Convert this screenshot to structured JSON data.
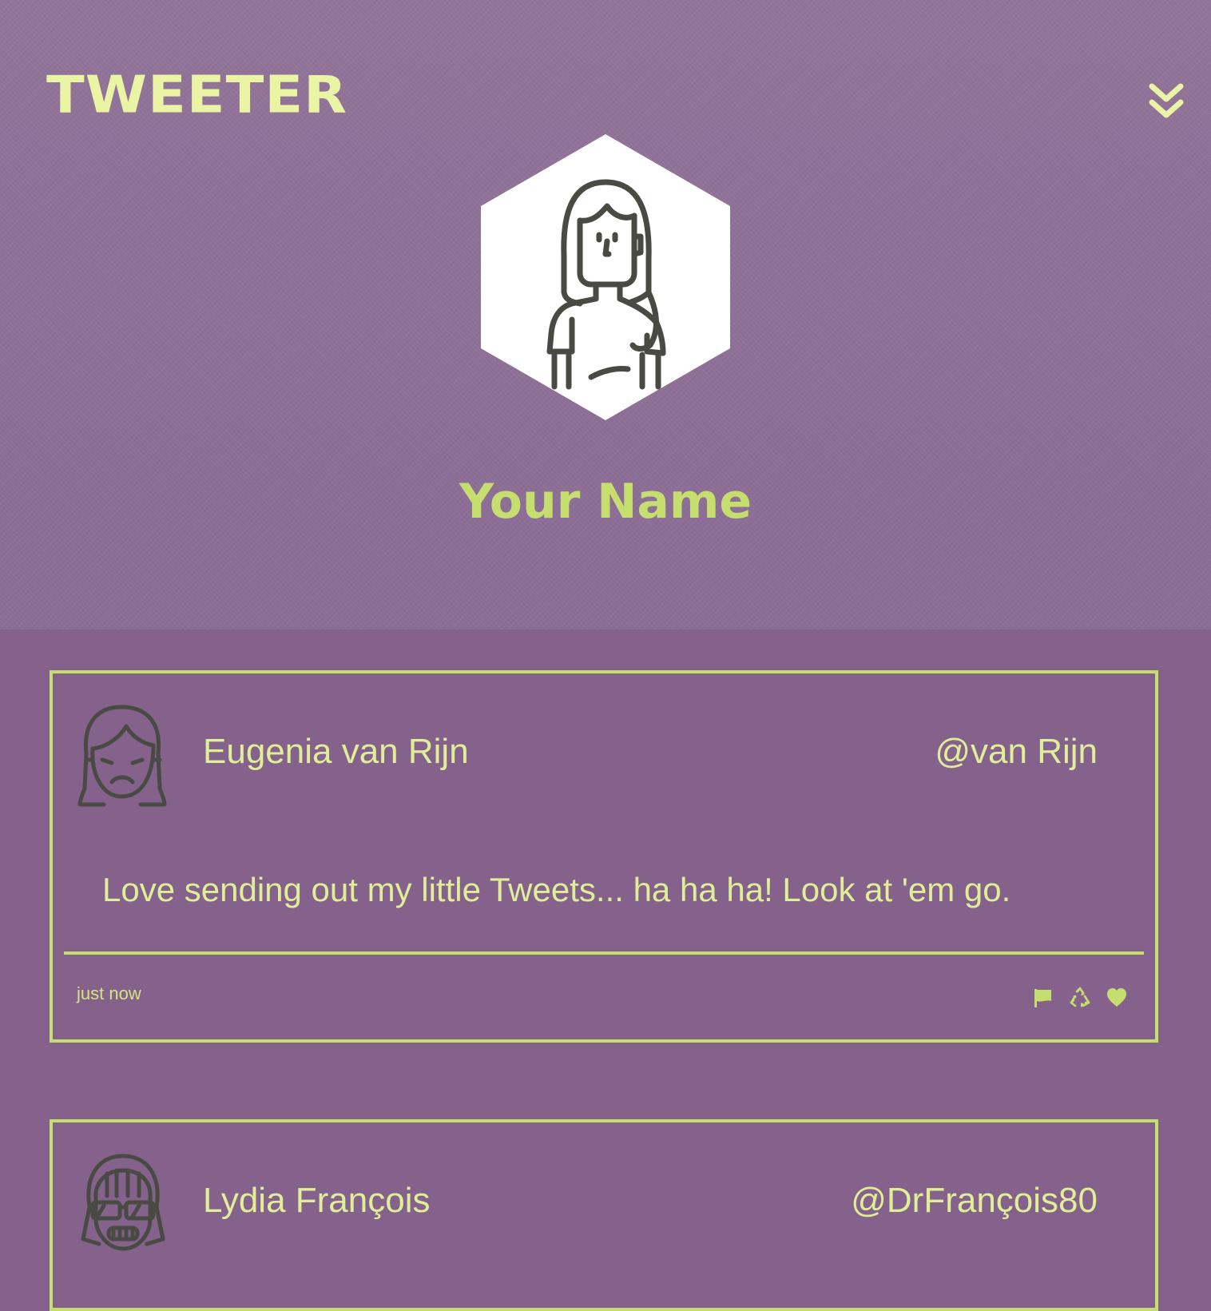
{
  "app": {
    "logo": "TWEETER",
    "menu_icon": "chevron-double-down-icon"
  },
  "profile": {
    "name": "Your Name",
    "avatar_icon": "woman-avatar-icon"
  },
  "colors": {
    "accent": "#c6de6d",
    "logo": "#e9f4a4",
    "header_bg": "#8d6f97",
    "feed_bg": "#84628b",
    "tweet_text": "#dfee97",
    "icon_stroke": "#4a4a44"
  },
  "tweets": [
    {
      "name": "Eugenia van Rijn",
      "handle": "@van Rijn",
      "text": "Love sending out my little Tweets... ha ha ha! Look at 'em go.",
      "time": "just now",
      "avatar_icon": "sad-woman-avatar-icon",
      "actions": [
        "flag-icon",
        "retweet-icon",
        "heart-icon"
      ]
    },
    {
      "name": "Lydia François",
      "handle": "@DrFrançois80",
      "avatar_icon": "sunglasses-woman-avatar-icon"
    }
  ]
}
